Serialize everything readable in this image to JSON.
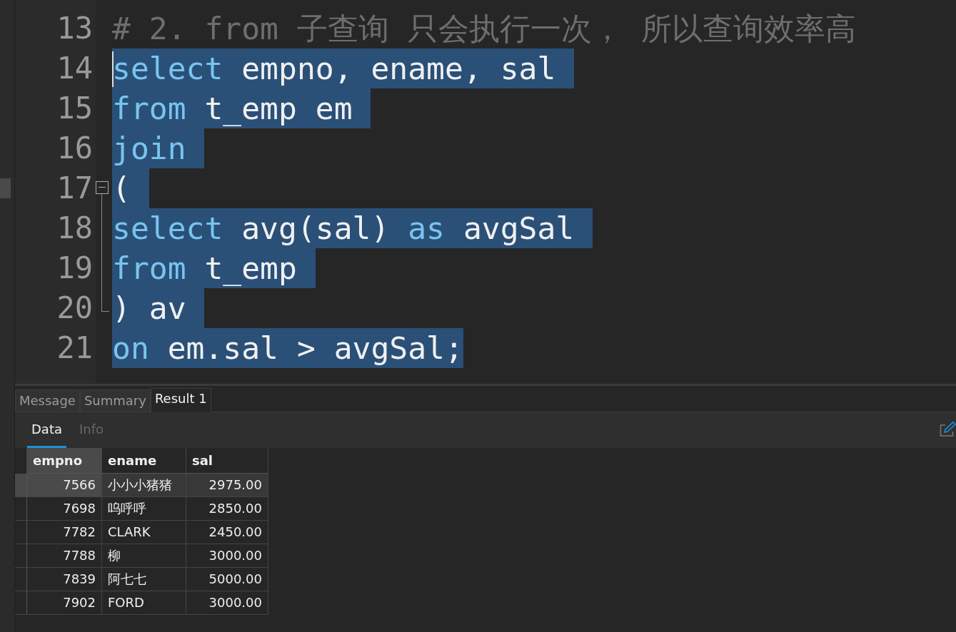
{
  "editor": {
    "lines": [
      {
        "number": "13",
        "selected": false,
        "kind": "plain",
        "tokens": [
          {
            "kind": "comment",
            "text": "# 2. from 子查询 只会执行一次， 所以查询效率高"
          }
        ]
      },
      {
        "number": "14",
        "selected": true,
        "kind": "plain",
        "tokens": [
          {
            "kind": "keyword",
            "text": "select"
          },
          {
            "kind": "plain",
            "text": " empno, ename, sal "
          }
        ]
      },
      {
        "number": "15",
        "selected": true,
        "kind": "plain",
        "tokens": [
          {
            "kind": "keyword",
            "text": "from"
          },
          {
            "kind": "plain",
            "text": " t_emp em "
          }
        ]
      },
      {
        "number": "16",
        "selected": true,
        "kind": "plain",
        "tokens": [
          {
            "kind": "keyword",
            "text": "join "
          }
        ]
      },
      {
        "number": "17",
        "selected": true,
        "kind": "foldstart",
        "tokens": [
          {
            "kind": "plain",
            "text": "( "
          }
        ]
      },
      {
        "number": "18",
        "selected": true,
        "kind": "foldinside",
        "tokens": [
          {
            "kind": "keyword",
            "text": "select"
          },
          {
            "kind": "plain",
            "text": " avg(sal) "
          },
          {
            "kind": "keyword",
            "text": "as"
          },
          {
            "kind": "plain",
            "text": " avgSal "
          }
        ]
      },
      {
        "number": "19",
        "selected": true,
        "kind": "foldinside",
        "tokens": [
          {
            "kind": "keyword",
            "text": "from"
          },
          {
            "kind": "plain",
            "text": " t_emp "
          }
        ]
      },
      {
        "number": "20",
        "selected": true,
        "kind": "foldend",
        "tokens": [
          {
            "kind": "plain",
            "text": ") av "
          }
        ]
      },
      {
        "number": "21",
        "selected": true,
        "kind": "plain",
        "tokens": [
          {
            "kind": "keyword",
            "text": "on"
          },
          {
            "kind": "plain",
            "text": " em.sal > avgSal;"
          }
        ]
      }
    ]
  },
  "result_tabs": [
    {
      "label": "Message",
      "selected": false
    },
    {
      "label": "Summary",
      "selected": false
    },
    {
      "label": "Result 1",
      "selected": true
    }
  ],
  "sub_tabs": [
    {
      "label": "Data",
      "selected": true
    },
    {
      "label": "Info",
      "selected": false
    }
  ],
  "table": {
    "columns": [
      "empno",
      "ename",
      "sal"
    ],
    "rows": [
      {
        "selected": true,
        "cells": [
          "7566",
          "小小小猪猪",
          "2975.00"
        ]
      },
      {
        "selected": false,
        "cells": [
          "7698",
          "呜呼呼",
          "2850.00"
        ]
      },
      {
        "selected": false,
        "cells": [
          "7782",
          "CLARK",
          "2450.00"
        ]
      },
      {
        "selected": false,
        "cells": [
          "7788",
          "柳",
          "3000.00"
        ]
      },
      {
        "selected": false,
        "cells": [
          "7839",
          "阿七七",
          "5000.00"
        ]
      },
      {
        "selected": false,
        "cells": [
          "7902",
          "FORD",
          "3000.00"
        ]
      }
    ]
  }
}
